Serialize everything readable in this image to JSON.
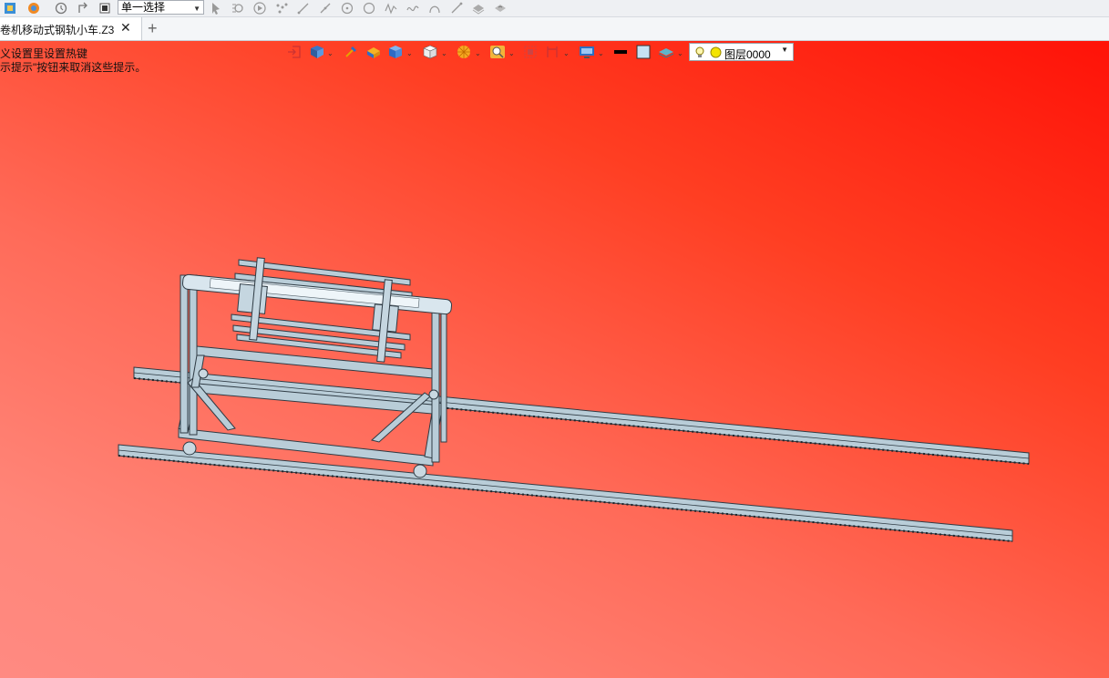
{
  "toolbar": {
    "selection_mode": "单一选择"
  },
  "tabs": {
    "document_title": "卷机移动式钢轨小车.Z3",
    "close_glyph": "✕",
    "new_tab_glyph": "+"
  },
  "viewport": {
    "hint_line_1": "义设置里设置热键",
    "hint_line_2": "示提示\"按钮来取消这些提示。",
    "layer_name": "图层0000",
    "background_colors": [
      "#ff1208",
      "#ff8a82"
    ],
    "model_color": "#b9cdd8"
  }
}
